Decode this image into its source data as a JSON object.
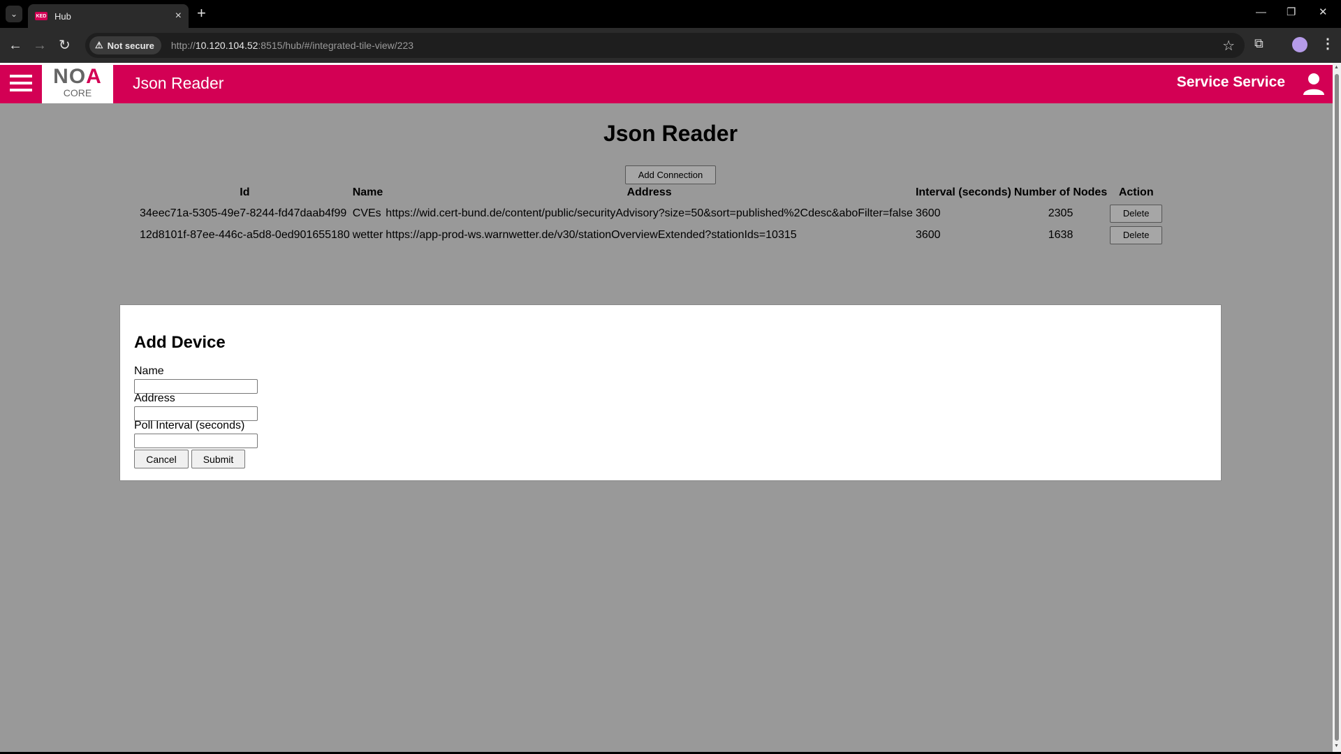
{
  "browser": {
    "tab_title": "Hub",
    "favicon_text": "KED",
    "security_label": "Not secure",
    "url_scheme": "http://",
    "url_host": "10.120.104.52",
    "url_rest": ":8515/hub/#/integrated-tile-view/223"
  },
  "appbar": {
    "logo_main_left": "NO",
    "logo_main_right": "A",
    "logo_sub": "CORE",
    "title": "Json Reader",
    "user_name": "Service Service"
  },
  "page": {
    "heading": "Json Reader",
    "add_connection_label": "Add Connection"
  },
  "table": {
    "headers": [
      "Id",
      "Name",
      "Address",
      "Interval (seconds)",
      "Number of Nodes",
      "Action"
    ],
    "rows": [
      {
        "id": "34eec71a-5305-49e7-8244-fd47daab4f99",
        "name": "CVEs",
        "address": "https://wid.cert-bund.de/content/public/securityAdvisory?size=50&sort=published%2Cdesc&aboFilter=false",
        "interval": "3600",
        "nodes": "2305",
        "action": "Delete"
      },
      {
        "id": "12d8101f-87ee-446c-a5d8-0ed901655180",
        "name": "wetter",
        "address": "https://app-prod-ws.warnwetter.de/v30/stationOverviewExtended?stationIds=10315",
        "interval": "3600",
        "nodes": "1638",
        "action": "Delete"
      }
    ]
  },
  "form": {
    "title": "Add Device",
    "name_label": "Name",
    "name_value": "",
    "address_label": "Address",
    "address_value": "",
    "interval_label": "Poll Interval (seconds)",
    "interval_value": "",
    "cancel_label": "Cancel",
    "submit_label": "Submit"
  },
  "colors": {
    "brand": "#d30054",
    "page_background": "#999999",
    "panel_background": "#ffffff"
  },
  "icons": {
    "menu": "hamburger-icon",
    "user": "user-icon",
    "warning": "warning-icon",
    "bookmark": "star-icon",
    "extensions": "puzzle-icon"
  }
}
